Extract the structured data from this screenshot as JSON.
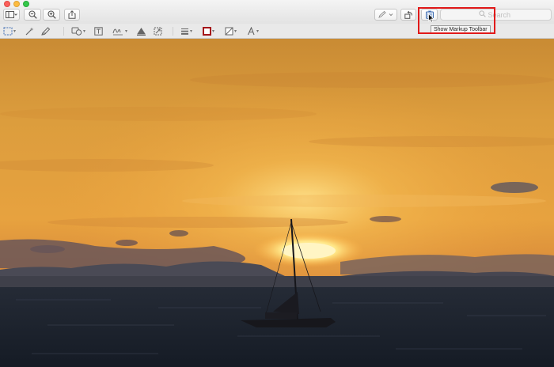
{
  "window": {
    "title": "",
    "controls": [
      "close",
      "minimize",
      "zoom"
    ]
  },
  "toolbar": {
    "left_buttons": [
      "sidebar-view-icon",
      "zoom-out-icon",
      "zoom-in-icon",
      "share-icon"
    ],
    "right_buttons": [
      "markup-pen-icon",
      "rotate-icon",
      "markup-toolbar-icon"
    ],
    "search": {
      "placeholder": "Search",
      "value": ""
    }
  },
  "tooltip": {
    "text": "Show Markup Toolbar"
  },
  "markup_toolbar": {
    "tools": [
      "rectangular-selection-icon",
      "instant-alpha-icon",
      "sketch-icon",
      "shapes-icon",
      "text-box-icon",
      "signature-icon",
      "adjust-color-icon",
      "adjust-size-icon",
      "shape-style-icon",
      "border-color-icon",
      "fill-color-icon",
      "text-style-icon"
    ]
  },
  "photo": {
    "subject": "sunset-sailboat",
    "colors": {
      "sky_top": "#d79a3a",
      "sky_mid": "#e8a43f",
      "sun": "#fff4b8",
      "sea": "#1d2430",
      "silhouette": "#1a1a1f"
    }
  },
  "annotation": {
    "highlight_color": "#e11a1a"
  }
}
